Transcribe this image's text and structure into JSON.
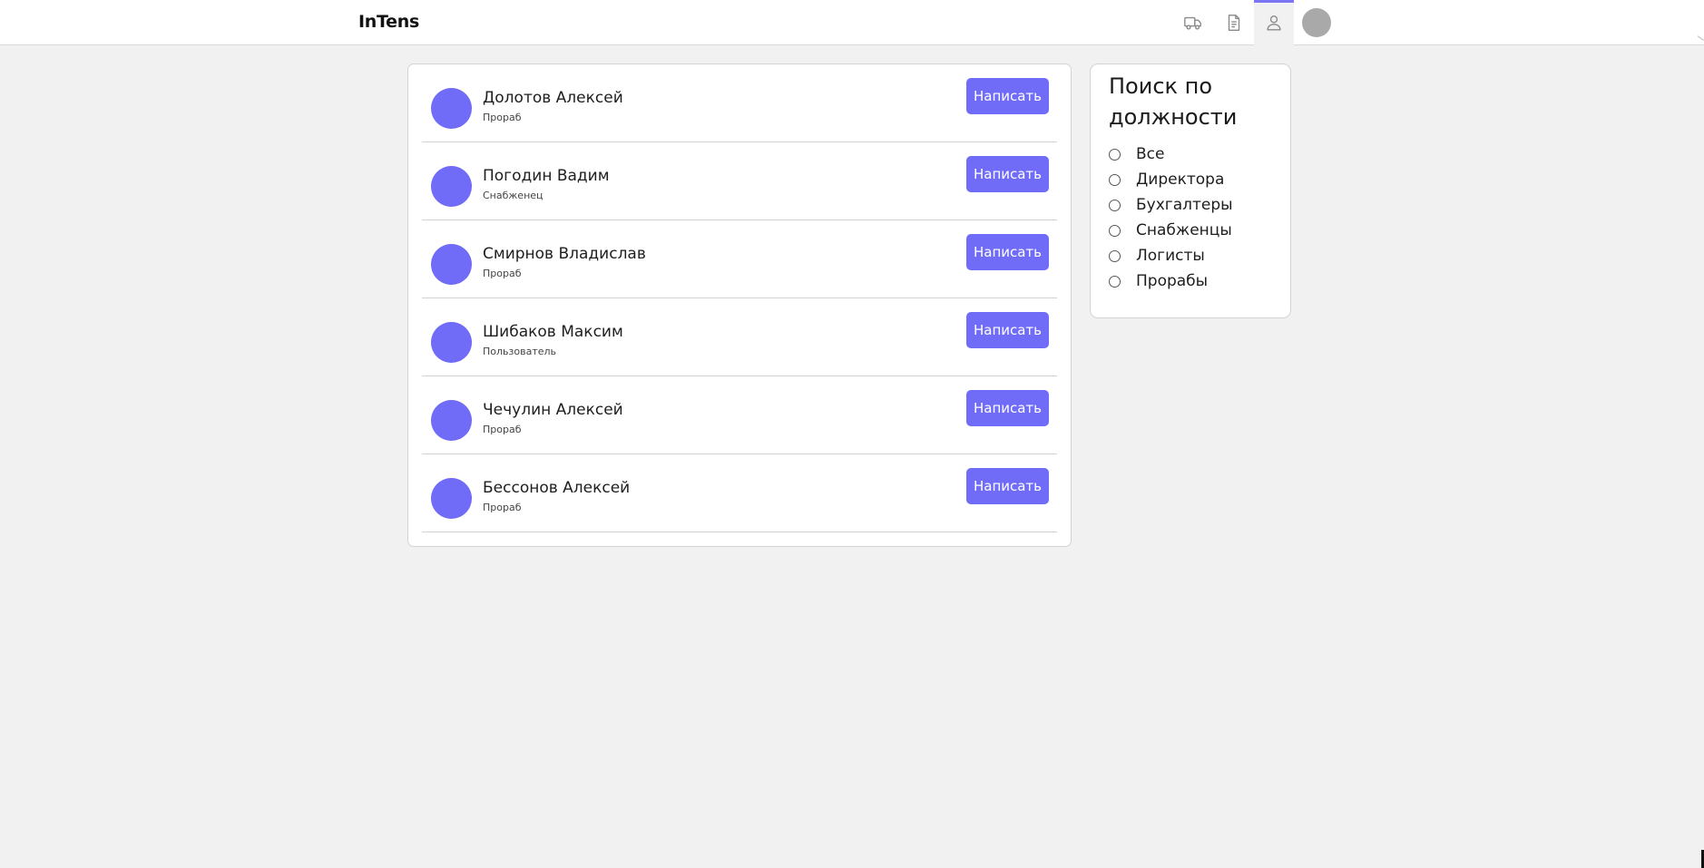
{
  "header": {
    "logo": "InTens",
    "nav": [
      {
        "icon": "truck-icon"
      },
      {
        "icon": "document-icon"
      },
      {
        "icon": "user-icon",
        "active": true
      }
    ],
    "avatar_color": "#a9a9a9"
  },
  "employees": [
    {
      "name": "Долотов Алексей",
      "role": "Прораб",
      "action": "Написать"
    },
    {
      "name": "Погодин Вадим",
      "role": "Снабженец",
      "action": "Написать"
    },
    {
      "name": "Смирнов Владислав",
      "role": "Прораб",
      "action": "Написать"
    },
    {
      "name": "Шибаков Максим",
      "role": "Пользователь",
      "action": "Написать"
    },
    {
      "name": "Чечулин Алексей",
      "role": "Прораб",
      "action": "Написать"
    },
    {
      "name": "Бессонов Алексей",
      "role": "Прораб",
      "action": "Написать"
    }
  ],
  "filter": {
    "title": "Поиск по должности",
    "options": [
      {
        "label": "Все"
      },
      {
        "label": "Директора"
      },
      {
        "label": "Бухгалтеры"
      },
      {
        "label": "Снабженцы"
      },
      {
        "label": "Логисты"
      },
      {
        "label": "Прорабы"
      }
    ]
  },
  "colors": {
    "accent": "#706cf7",
    "background": "#f1f1f1",
    "card": "#ffffff"
  }
}
